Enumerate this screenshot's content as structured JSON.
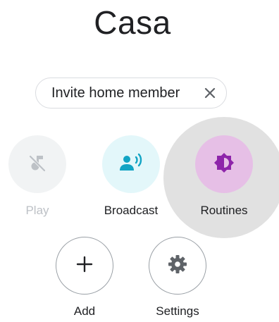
{
  "page": {
    "title": "Casa"
  },
  "invite_chip": {
    "label": "Invite home member",
    "close_icon": "close-icon"
  },
  "actions": [
    {
      "label": "Play",
      "icon": "music-off-icon",
      "enabled": false
    },
    {
      "label": "Broadcast",
      "icon": "broadcast-icon",
      "enabled": true
    },
    {
      "label": "Routines",
      "icon": "routines-icon",
      "enabled": true
    },
    {
      "label": "Add",
      "icon": "plus-icon",
      "enabled": true
    },
    {
      "label": "Settings",
      "icon": "gear-icon",
      "enabled": true
    }
  ],
  "colors": {
    "text": "#202124",
    "disabled_text": "#bdc1c6",
    "broadcast_accent": "#12a4c4",
    "routines_accent": "#8e24aa",
    "neutral_icon": "#5f6368"
  }
}
